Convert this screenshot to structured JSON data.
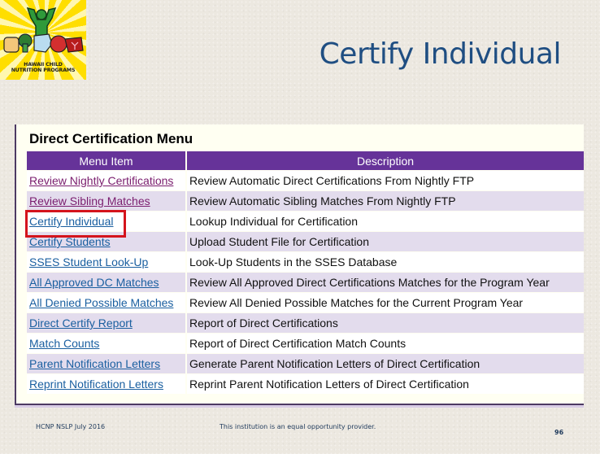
{
  "logo": {
    "line1": "HAWAII CHILD",
    "line2": "NUTRITION PROGRAMS",
    "colors": {
      "background": "#ffe200",
      "person": "#2f9a3a"
    }
  },
  "slide": {
    "title": "Certify Individual",
    "title_color": "#1f4e82"
  },
  "menu": {
    "title": "Direct Certification Menu",
    "header_color": "#663399",
    "columns": [
      "Menu Item",
      "Description"
    ],
    "rows": [
      {
        "item": "Review Nightly Certifications",
        "description": "Review Automatic Direct Certifications From Nightly FTP",
        "visited": true
      },
      {
        "item": "Review Sibling Matches",
        "description": "Review Automatic Sibling Matches From Nightly FTP",
        "visited": true
      },
      {
        "item": "Certify Individual",
        "description": "Lookup Individual for Certification",
        "visited": false,
        "highlighted": true
      },
      {
        "item": "Certify Students",
        "description": "Upload Student File for Certification",
        "visited": false
      },
      {
        "item": "SSES Student Look-Up",
        "description": "Look-Up Students in the SSES Database",
        "visited": false
      },
      {
        "item": "All Approved DC Matches",
        "description": "Review All Approved Direct Certifications Matches for the Program Year",
        "visited": false
      },
      {
        "item": "All Denied Possible Matches",
        "description": "Review All Denied Possible Matches for the Current Program Year",
        "visited": false
      },
      {
        "item": "Direct Certify Report",
        "description": "Report of Direct Certifications",
        "visited": false
      },
      {
        "item": "Match Counts",
        "description": "Report of Direct Certification Match Counts",
        "visited": false
      },
      {
        "item": "Parent Notification Letters",
        "description": "Generate Parent Notification Letters of Direct Certification",
        "visited": false
      },
      {
        "item": "Reprint Notification Letters",
        "description": "Reprint Parent Notification Letters of Direct Certification",
        "visited": false
      }
    ],
    "highlight_color": "#d4141c"
  },
  "footer": {
    "left": "HCNP NSLP July 2016",
    "center": "This institution is an equal opportunity provider.",
    "page": "96"
  }
}
